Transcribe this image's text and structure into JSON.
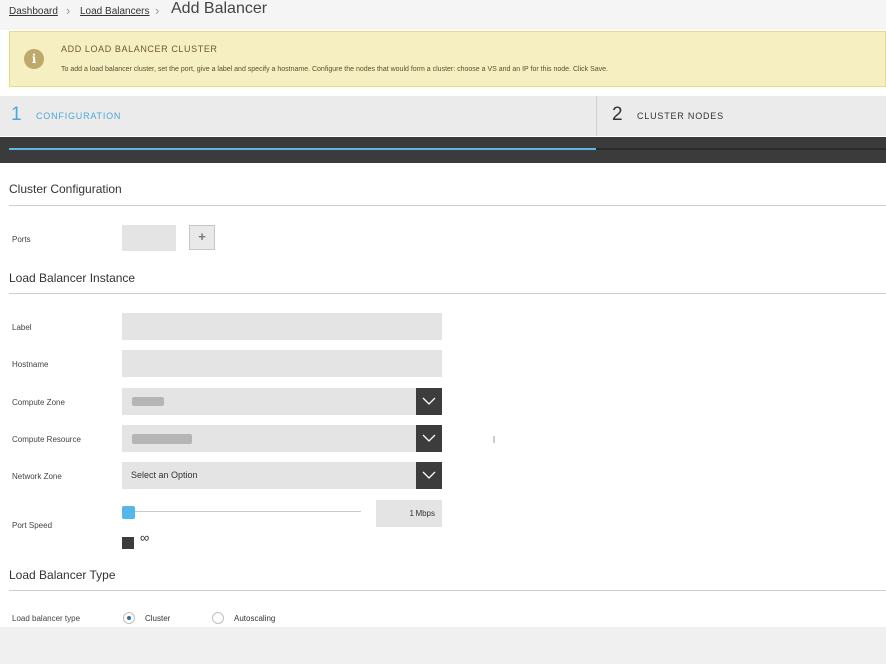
{
  "breadcrumb": {
    "items": [
      "Dashboard",
      "Load Balancers"
    ],
    "current": "Add Balancer"
  },
  "alert": {
    "icon": "info-icon",
    "title": "ADD LOAD BALANCER CLUSTER",
    "text": "To add a load balancer cluster, set the port, give a label and specify a hostname. Configure the nodes that would form a cluster: choose a VS and an IP for this node. Click Save."
  },
  "steps": [
    {
      "number": "1",
      "label": "CONFIGURATION",
      "active": true
    },
    {
      "number": "2",
      "label": "CLUSTER NODES",
      "active": false
    }
  ],
  "colors": {
    "accent": "#5cb8e6",
    "dark": "#3b3b3b",
    "alert_bg": "#f6efc1"
  },
  "cluster_config": {
    "title": "Cluster Configuration",
    "ports_label": "Ports",
    "ports_value": "",
    "add_port_symbol": "+"
  },
  "instance": {
    "title": "Load Balancer Instance",
    "label_label": "Label",
    "label_value": "",
    "hostname_label": "Hostname",
    "hostname_value": "",
    "compute_zone_label": "Compute Zone",
    "compute_resource_label": "Compute Resource",
    "network_zone_label": "Network Zone",
    "network_zone_value": "Select an Option",
    "port_speed_label": "Port Speed",
    "port_speed_value": "1",
    "port_speed_unit": "Mbps",
    "unlimited_symbol": "∞"
  },
  "lb_type": {
    "title": "Load Balancer Type",
    "label": "Load balancer type",
    "options": [
      {
        "label": "Cluster",
        "checked": true
      },
      {
        "label": "Autoscaling",
        "checked": false
      }
    ]
  }
}
